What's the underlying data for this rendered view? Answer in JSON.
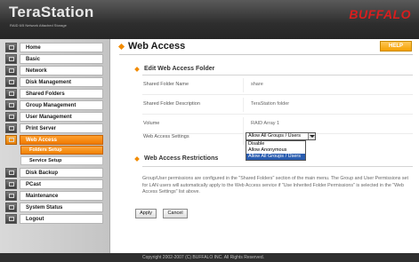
{
  "header": {
    "product_name": "TeraStation",
    "product_tagline": "RAID 6/5 Network Attached Storage",
    "brand": "BUFFALO"
  },
  "sidebar": {
    "items": [
      {
        "label": "Home",
        "icon": "home-icon"
      },
      {
        "label": "Basic",
        "icon": "basic-icon"
      },
      {
        "label": "Network",
        "icon": "network-icon"
      },
      {
        "label": "Disk Management",
        "icon": "disk-icon"
      },
      {
        "label": "Shared Folders",
        "icon": "folder-icon"
      },
      {
        "label": "Group Management",
        "icon": "group-icon"
      },
      {
        "label": "User Management",
        "icon": "user-icon"
      },
      {
        "label": "Print Server",
        "icon": "printer-icon"
      },
      {
        "label": "Web Access",
        "icon": "web-icon",
        "active": true
      },
      {
        "label": "Disk Backup",
        "icon": "backup-icon"
      },
      {
        "label": "PCast",
        "icon": "pcast-icon"
      },
      {
        "label": "Maintenance",
        "icon": "maintenance-icon"
      },
      {
        "label": "System Status",
        "icon": "status-icon"
      },
      {
        "label": "Logout",
        "icon": "logout-icon"
      }
    ],
    "sub_items": [
      {
        "label": "Folders Setup",
        "selected": true
      },
      {
        "label": "Service Setup",
        "selected": false
      }
    ]
  },
  "main": {
    "title": "Web Access",
    "help_label": "HELP",
    "folder_section": {
      "title": "Edit Web Access Folder",
      "rows": [
        {
          "label": "Shared Folder Name",
          "value": "share"
        },
        {
          "label": "Shared Folder Description",
          "value": "TeraStation folder"
        },
        {
          "label": "Volume",
          "value": "RAID Array 1"
        },
        {
          "label": "Web Access Settings",
          "value": ""
        }
      ],
      "web_access_select": {
        "selected": "Allow All Groups / Users",
        "options": [
          "Disable",
          "Allow Anonymous",
          "Allow All Groups / Users"
        ]
      }
    },
    "restrictions_section": {
      "title": "Web Access Restrictions",
      "text": "Group/User permissions are configured in the \"Shared Folders\" section of the main menu. The Group and User Permissions set for LAN users will automatically apply to the Web Access service if \"Use Inherited Folder Permissions\" is selected in the \"Web Access Settings\" list above."
    },
    "apply_label": "Apply",
    "cancel_label": "Cancel"
  },
  "footer": {
    "copyright": "Copyright 2002-2007 (C) BUFFALO INC. All Rights Reserved."
  },
  "colors": {
    "accent": "#f28b00",
    "brand": "#d81e1e",
    "header_bg": "#2e2e2e"
  }
}
